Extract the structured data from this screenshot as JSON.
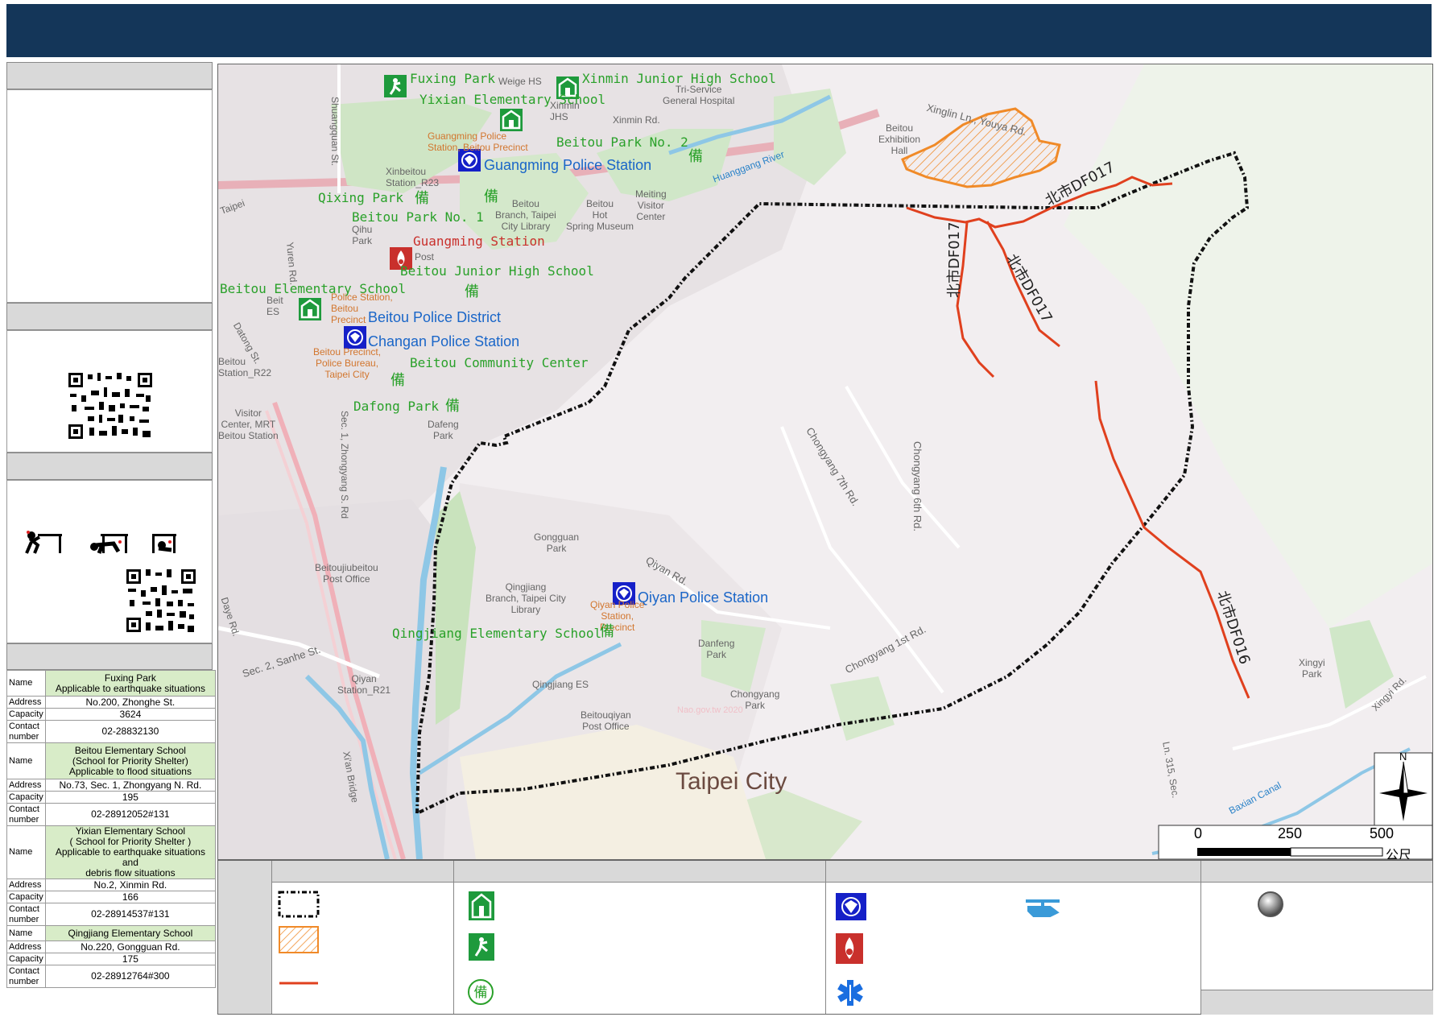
{
  "map": {
    "places": {
      "fuxing_park": "Fuxing Park",
      "weige_hs": "Weige HS",
      "yixian": "Yixian Elementary School",
      "xinmin": "Xinmin Junior High School",
      "tri_service": "Tri-Service\nGeneral Hospital",
      "xinmin_jhs": "Xinmin\nJHS",
      "xinmin_rd": "Xinmin Rd.",
      "guangming_police_small": "Guangming Police\nStation, Beitou Precinct",
      "beitou_park_no2": "Beitou Park No. 2",
      "guangming_police": "Guangming Police Station",
      "xinbeitou": "Xinbeitou\nStation_R23",
      "qixing_park": "Qixing Park",
      "beitou_park_no1": "Beitou Park No. 1",
      "qihu_park": "Qihu\nPark",
      "beitou_branch": "Beitou\nBranch, Taipei\nCity Library",
      "hot_spring": "Beitou\nHot\nSpring Museum",
      "meiting": "Meiting\nVisitor\nCenter",
      "guangming_station": "Guangming Station",
      "post": "Post",
      "beitou_jhs": "Beitou Junior High School",
      "beitou_es": "Beitou Elementary School",
      "beitou_police_small": "Police Station,\nBeitou\nPrecinct",
      "beitou_district": "Beitou Police District",
      "changan": "Changan Police Station",
      "beitou_community": "Beitou Community Center",
      "beitou_precinct": "Beitou Precinct,\nPolice Bureau,\nTaipei City",
      "beitou_station": "Beitou\nStation_R22",
      "dafong_park": "Dafong Park",
      "dafeng_park": "Dafeng\nPark",
      "visitor_center": "Visitor\nCenter, MRT\nBeitou Station",
      "es_small": "Beit\nES",
      "exhibition": "Beitou\nExhibition\nHall",
      "xinglin": "Xinglin Ln., Youya Rd.",
      "huanggang": "Huanggang River",
      "shuangquan": "Shuangquan St.",
      "yuren": "Yuren Rd.",
      "datong": "Datong St.",
      "taipei": "Taipei",
      "zhongyang": "Sec. 1, Zhongyang S. Rd",
      "chongyang7": "Chongyang 7th Rd.",
      "chongyang6": "Chongyang 6th Rd.",
      "chongyang1": "Chongyang 1st Rd.",
      "gongguan_park": "Gongguan\nPark",
      "qiyan_rd": "Qiyan Rd.",
      "qiyan_police": "Qiyan Police Station",
      "qingjiang_lib": "Qingjiang\nBranch, Taipei City\nLibrary",
      "qiyan_precinct": "Qiyan Police\nStation,\nPrecinct",
      "qingjiang_es": "Qingjiang Elementary School",
      "qingjiang_es_small": "Qingjiang ES",
      "danfeng": "Danfeng\nPark",
      "chongyang_park": "Chongyang\nPark",
      "beitouqiyan_post": "Beitouqiyan\nPost Office",
      "beitoujiubeitou": "Beitoujiubeitou\nPost Office",
      "daye": "Daye Rd.",
      "sanhe": "Sec. 2, Sanhe St.",
      "qiyan_station": "Qiyan\nStation_R21",
      "xian_bridge": "Xi'an Bridge",
      "taipei_city": "Taipei City",
      "xingyi_park": "Xingyi\nPark",
      "xingyi_rd": "Xingyi Rd.",
      "baxian": "Baxian Canal",
      "ln315": "Ln. 315, Sec.",
      "df017a": "北市DF017",
      "df017b": "北市DF017",
      "df017c": "北市DF017",
      "df016": "北市DF016",
      "watermark": "Nao.gov.tw 2020",
      "bei": "備"
    },
    "scale": {
      "n": "N",
      "s0": "0",
      "s250": "250",
      "s500": "500",
      "unit": "公尺"
    }
  },
  "shelters": [
    {
      "name_lines": [
        "Fuxing Park",
        "Applicable to earthquake situations"
      ],
      "address": "No.200, Zhonghe St.",
      "capacity": "3624",
      "contact": "02-28832130"
    },
    {
      "name_lines": [
        "Beitou Elementary School",
        "(School for Priority Shelter)",
        "Applicable to flood situations"
      ],
      "address": "No.73, Sec. 1, Zhongyang N. Rd.",
      "capacity": "195",
      "contact": "02-28912052#131"
    },
    {
      "name_lines": [
        "Yixian Elementary School",
        "( School for Priority Shelter )",
        "Applicable to earthquake situations and",
        "debris flow situations"
      ],
      "address": "No.2, Xinmin Rd.",
      "capacity": "166",
      "contact": "02-28914537#131"
    },
    {
      "name_lines": [
        "Qingjiang Elementary School"
      ],
      "address": "No.220, Gongguan Rd.",
      "capacity": "175",
      "contact": "02-28912764#300"
    }
  ],
  "table_keys": {
    "name": "Name",
    "address": "Address",
    "capacity": "Capacity",
    "contact": "Contact\nnumber"
  },
  "colors": {
    "header": "#143659",
    "shelter_green": "#1e9a3c",
    "police_blue": "#1520c8",
    "fire_red": "#c9302c",
    "debris_red": "#e0401e",
    "landslide_orange": "#f08a28"
  },
  "legend_icons": [
    "boundary-line",
    "landslide-hatch",
    "debris-flow-line",
    "school-shelter-icon",
    "park-shelter-icon",
    "reserve-shelter-icon",
    "police-icon",
    "helicopter-icon",
    "fire-station-icon",
    "medical-icon",
    "circle-marker-icon"
  ]
}
